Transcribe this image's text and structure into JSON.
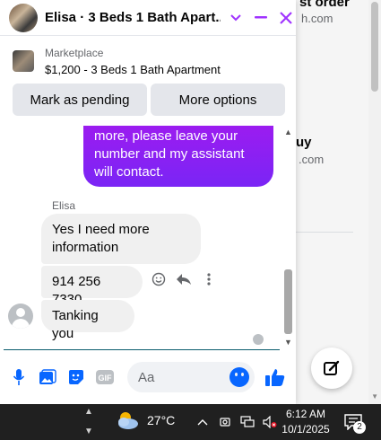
{
  "background_page": {
    "item1_title": "st order",
    "item1_sub": "h.com",
    "item2_title": "uy",
    "item2_sub": ".com"
  },
  "chat": {
    "contact_name": "Elisa",
    "title": "Elisa · 3 Beds 1 Bath Apart...",
    "marketplace": {
      "label": "Marketplace",
      "listing": "$1,200 - 3 Beds 1 Bath Apartment"
    },
    "actions": {
      "mark_pending": "Mark as pending",
      "more_options": "More options"
    },
    "messages": {
      "outgoing_text": "more, please leave your number and my assistant will contact.",
      "sender_label": "Elisa",
      "incoming": [
        "Yes I need more information",
        "914 256 7330",
        "Tanking you"
      ]
    },
    "composer": {
      "placeholder": "Aa"
    },
    "accent_color": "#a033ff",
    "icon_color": "#0866ff"
  },
  "taskbar": {
    "temperature": "27°C",
    "time": "6:12 AM",
    "date": "10/1/2025",
    "notification_count": "2"
  }
}
